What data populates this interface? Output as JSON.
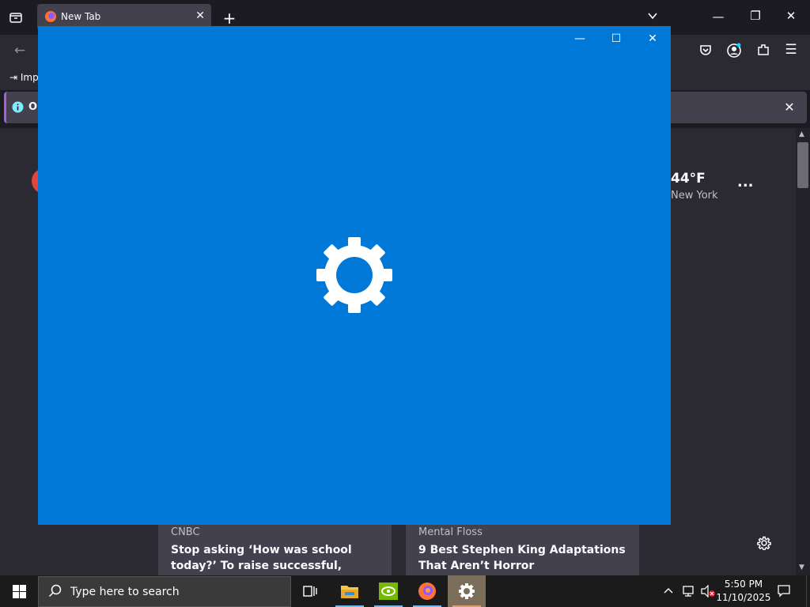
{
  "browser": {
    "tab_title": "New Tab",
    "bookmark_text": "Imp",
    "infobar_text": "O"
  },
  "newtab": {
    "weather": {
      "temp": "44°F",
      "city": "New York",
      "more": "..."
    },
    "stories": [
      {
        "source": "CNBC",
        "headline": "Stop asking ‘How was school today?’ To raise successful, mentally strong"
      },
      {
        "source": "Mental Floss",
        "headline": "9 Best Stephen King Adaptations That Aren’t Horror"
      }
    ]
  },
  "splash": {
    "app": "Settings",
    "icon": "gear-icon",
    "background": "#0078d7"
  },
  "taskbar": {
    "search_placeholder": "Type here to search",
    "time": "5:50 PM",
    "date": "11/10/2025"
  }
}
